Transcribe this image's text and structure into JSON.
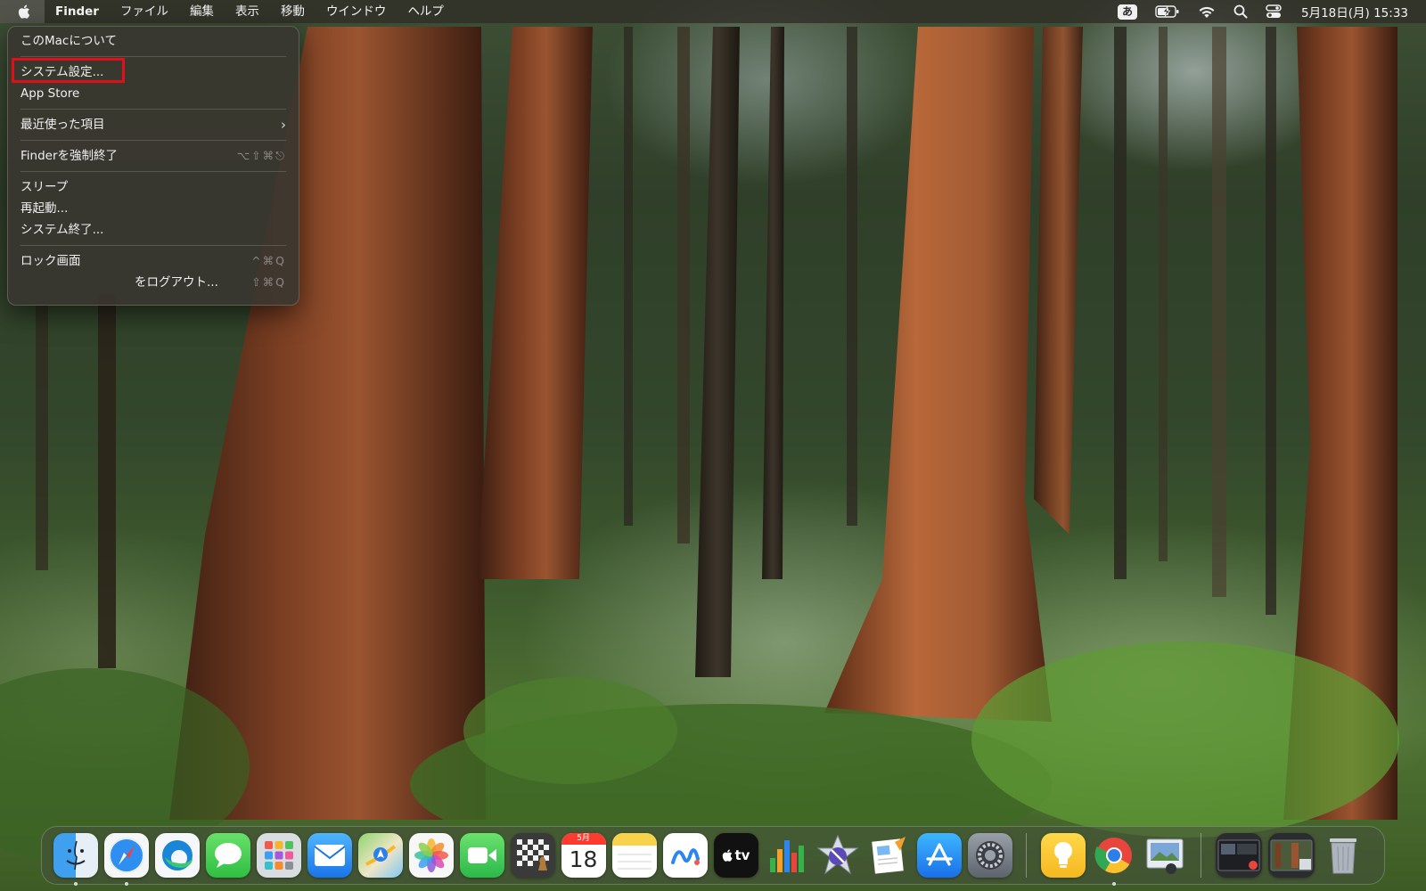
{
  "menubar": {
    "apple_icon": "apple-logo-icon",
    "app_name": "Finder",
    "menus": [
      "ファイル",
      "編集",
      "表示",
      "移動",
      "ウインドウ",
      "ヘルプ"
    ],
    "status": {
      "input_method": "あ",
      "battery_icon": "battery-charging-icon",
      "wifi_icon": "wifi-icon",
      "search_icon": "spotlight-search-icon",
      "control_center_icon": "control-center-icon",
      "clock": "5月18日(月) 15:33"
    }
  },
  "apple_menu": {
    "about": "このMacについて",
    "system_settings": "システム設定...",
    "app_store": "App Store",
    "recent_items": "最近使った項目",
    "force_quit": "Finderを強制終了",
    "force_quit_shortcut": "⌥⇧⌘⎋",
    "sleep": "スリープ",
    "restart": "再起動...",
    "shutdown": "システム終了...",
    "lock_screen": "ロック画面",
    "lock_screen_shortcut": "^⌘Q",
    "logout": "をログアウト...",
    "logout_shortcut": "⇧⌘Q",
    "highlight_color": "#e0101a"
  },
  "dock": {
    "calendar_month": "5月",
    "calendar_day": "18",
    "tv_label": "tv",
    "apps": [
      {
        "name": "Finder",
        "icon": "finder-icon",
        "running": true
      },
      {
        "name": "Safari",
        "icon": "safari-icon",
        "running": true
      },
      {
        "name": "Microsoft Edge",
        "icon": "edge-icon",
        "running": false
      },
      {
        "name": "メッセージ",
        "icon": "messages-icon",
        "running": false
      },
      {
        "name": "Launchpad",
        "icon": "launchpad-icon",
        "running": false
      },
      {
        "name": "メール",
        "icon": "mail-icon",
        "running": false
      },
      {
        "name": "マップ",
        "icon": "maps-icon",
        "running": false
      },
      {
        "name": "写真",
        "icon": "photos-icon",
        "running": false
      },
      {
        "name": "FaceTime",
        "icon": "facetime-icon",
        "running": false
      },
      {
        "name": "チェス",
        "icon": "chess-icon",
        "running": false
      },
      {
        "name": "カレンダー",
        "icon": "calendar-icon",
        "running": false
      },
      {
        "name": "メモ",
        "icon": "notes-icon",
        "running": true
      },
      {
        "name": "フリーボード",
        "icon": "freeform-icon",
        "running": false
      },
      {
        "name": "TV",
        "icon": "apple-tv-icon",
        "running": false
      },
      {
        "name": "Numbers",
        "icon": "numbers-icon",
        "running": false
      },
      {
        "name": "Instruments",
        "icon": "instruments-icon",
        "running": false
      },
      {
        "name": "Pages",
        "icon": "pages-icon",
        "running": false
      },
      {
        "name": "App Store",
        "icon": "app-store-icon",
        "running": false
      },
      {
        "name": "システム設定",
        "icon": "system-settings-icon",
        "running": false
      },
      {
        "name": "ヒント",
        "icon": "tips-lightbulb-icon",
        "running": false
      },
      {
        "name": "Google Chrome",
        "icon": "chrome-icon",
        "running": true
      },
      {
        "name": "プレビュー",
        "icon": "preview-icon",
        "running": false
      },
      {
        "name": "最近の書類1",
        "icon": "recent-window-thumbnail-icon",
        "running": false
      },
      {
        "name": "最近の書類2",
        "icon": "recent-window-thumbnail-icon",
        "running": false
      },
      {
        "name": "ゴミ箱",
        "icon": "trash-icon",
        "running": false
      }
    ]
  }
}
